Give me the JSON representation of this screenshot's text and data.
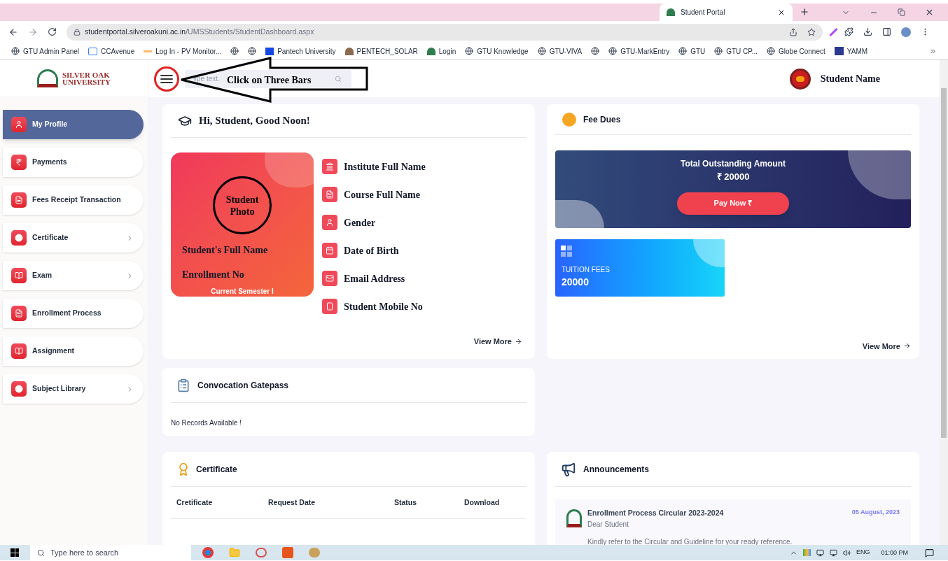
{
  "browser": {
    "tab": {
      "title": "Student Portal"
    },
    "url": {
      "host": "studentportal.silveroakuni.ac.in",
      "path": "/UMSStudents/StudentDashboard.aspx"
    },
    "bookmarks": [
      {
        "kind": "globe",
        "label": "GTU Admin Panel"
      },
      {
        "kind": "cc",
        "label": "CCAvenue"
      },
      {
        "kind": "dash",
        "label": "Log In - PV Monitor..."
      },
      {
        "kind": "globe"
      },
      {
        "kind": "globe"
      },
      {
        "kind": "ps",
        "label": "Pantech University"
      },
      {
        "kind": "solar",
        "label": "PENTECH_SOLAR"
      },
      {
        "kind": "portal",
        "label": "Login"
      },
      {
        "kind": "globe",
        "label": "GTU Knowledge"
      },
      {
        "kind": "globe",
        "label": "GTU-VIVA"
      },
      {
        "kind": "globe"
      },
      {
        "kind": "globe",
        "label": "GTU-MarkEntry"
      },
      {
        "kind": "globe",
        "label": "GTU"
      },
      {
        "kind": "globe",
        "label": "GTU CP..."
      },
      {
        "kind": "globe",
        "label": "Globe Connect"
      },
      {
        "kind": "yamm",
        "label": "YAMM"
      }
    ]
  },
  "sidebar": {
    "logo": {
      "line1": "SILVER OAK",
      "line2": "UNIVERSITY"
    },
    "items": [
      {
        "label": "My Profile",
        "selected": true,
        "has_submenu": false
      },
      {
        "label": "Payments",
        "selected": false,
        "has_submenu": false
      },
      {
        "label": "Fees Receipt Transaction",
        "selected": false,
        "has_submenu": false
      },
      {
        "label": "Certificate",
        "selected": false,
        "has_submenu": true
      },
      {
        "label": "Exam",
        "selected": false,
        "has_submenu": true
      },
      {
        "label": "Enrollment Process",
        "selected": false,
        "has_submenu": false
      },
      {
        "label": "Assignment",
        "selected": false,
        "has_submenu": false
      },
      {
        "label": "Subject Library",
        "selected": false,
        "has_submenu": true
      }
    ]
  },
  "header": {
    "search": {
      "placeholder": "ype text."
    },
    "annotation": "Click on Three Bars",
    "user_name": "Student Name"
  },
  "profile_card": {
    "greeting": "Hi, Student, Good Noon!",
    "photo_label": "Student Photo",
    "full_name": "Student's Full Name",
    "enrollment": "Enrollment No",
    "semester": "Current Semester I",
    "details": [
      "Institute Full Name",
      "Course Full Name",
      "Gender",
      "Date of Birth",
      "Email Address",
      "Student Mobile No"
    ],
    "view_more": "View More"
  },
  "fee_dues": {
    "title": "Fee Dues",
    "outstanding": {
      "label": "Total Outstanding Amount",
      "amount": "₹ 20000",
      "pay_button": "Pay Now ₹"
    },
    "tuition": {
      "label": "TUITION FEES",
      "amount": "20000"
    },
    "view_more": "View More"
  },
  "convocation": {
    "title": "Convocation Gatepass",
    "message": "No Records Available !"
  },
  "certificate": {
    "title": "Certificate",
    "columns": [
      "Cretificate",
      "Request Date",
      "Status",
      "Download"
    ]
  },
  "announcements": {
    "title": "Announcements",
    "items": [
      {
        "title": "Enrollment Process Circular 2023-2024",
        "date": "05 August, 2023",
        "subtitle": "Dear Student",
        "body": "Kindly refer to the Circular and Guideline for your ready reference."
      }
    ]
  },
  "taskbar": {
    "search_placeholder": "Type here to search",
    "language": "ENG",
    "time": "01:00 PM"
  }
}
